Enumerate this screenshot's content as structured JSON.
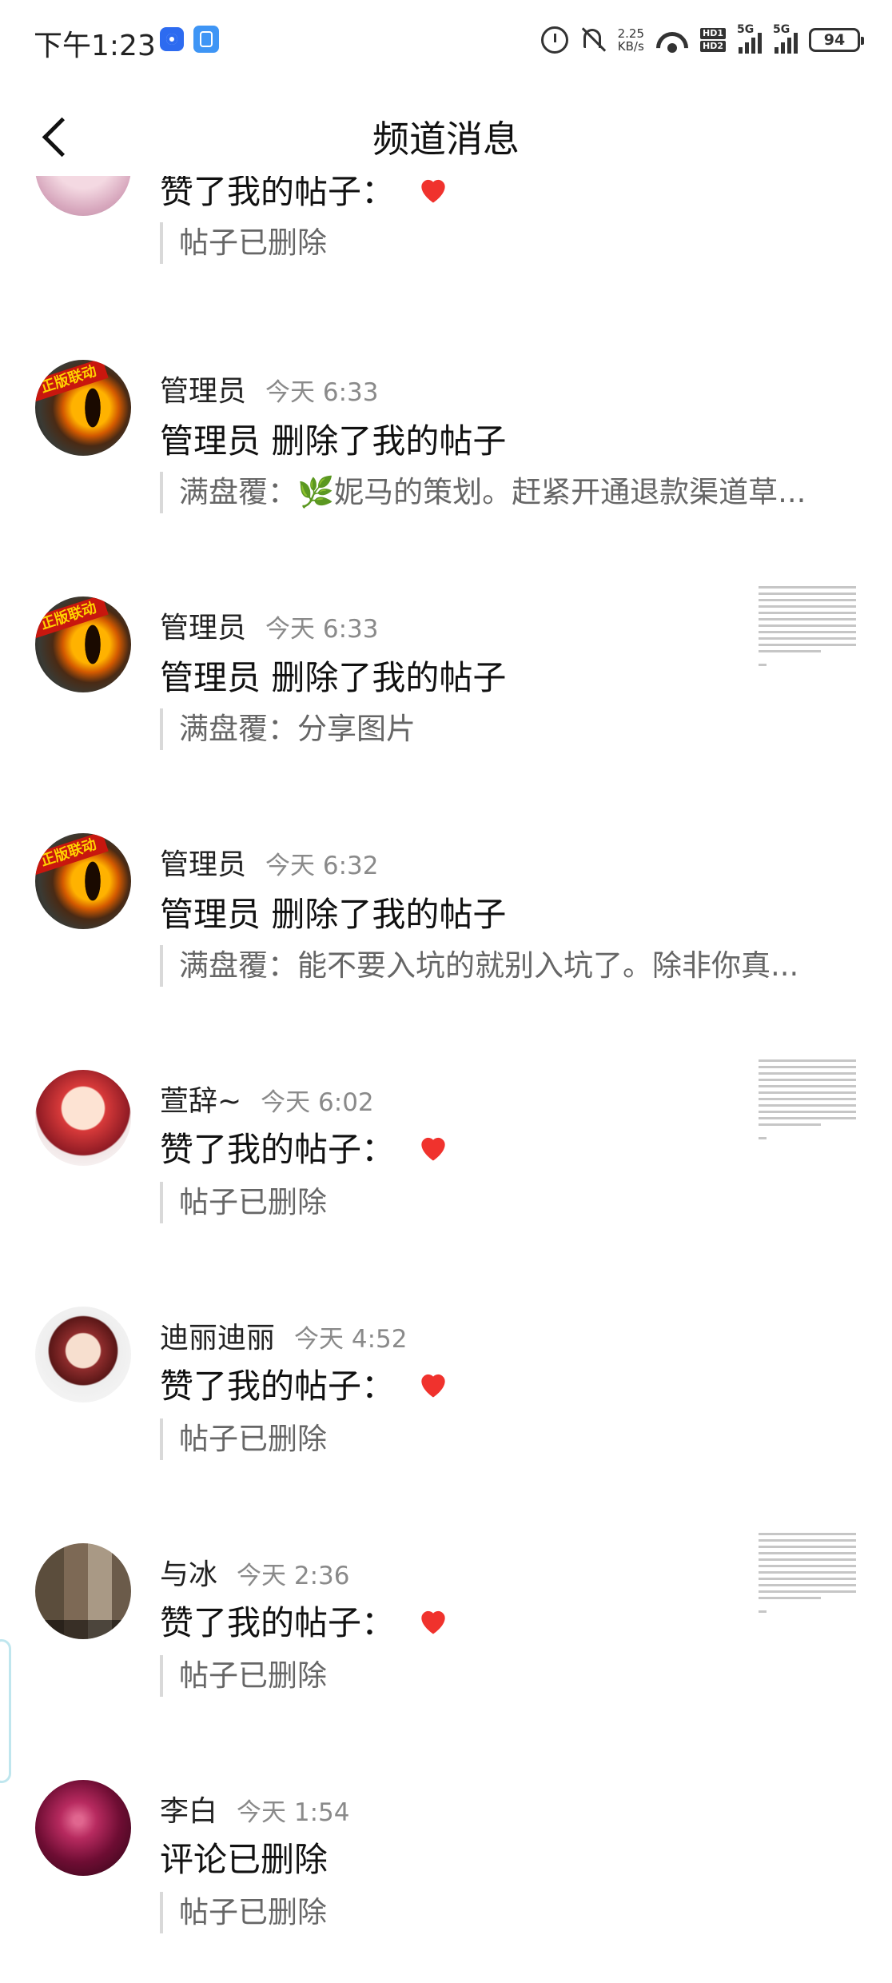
{
  "status_bar": {
    "time": "下午1:23",
    "speed_value": "2.25",
    "speed_unit": "KB/s",
    "hd1": "HD1",
    "hd2": "HD2",
    "net1": "5G",
    "net2": "5G",
    "battery": "94"
  },
  "header": {
    "title": "频道消息"
  },
  "messages": [
    {
      "name": "",
      "time": "",
      "action": "赞了我的帖子：",
      "heart": true,
      "quote": "帖子已删除",
      "avatar": "pink-avatar"
    },
    {
      "name": "管理员",
      "time": "今天 6:33",
      "action": "管理员 删除了我的帖子",
      "heart": false,
      "quote_prefix": "满盘覆：",
      "quote_emoji": "🌿",
      "quote": "妮马的策划。赶紧开通退款渠道草...",
      "avatar": "dragon-eye-avatar"
    },
    {
      "name": "管理员",
      "time": "今天 6:33",
      "action": "管理员 删除了我的帖子",
      "heart": false,
      "quote": "满盘覆：分享图片",
      "avatar": "dragon-eye-avatar",
      "banner": "正版联动"
    },
    {
      "name": "管理员",
      "time": "今天 6:32",
      "action": "管理员 删除了我的帖子",
      "heart": false,
      "quote": "满盘覆：能不要入坑的就别入坑了。除非你真...",
      "avatar": "dragon-eye-avatar"
    },
    {
      "name": "萱辞~",
      "time": "今天 6:02",
      "action": "赞了我的帖子：",
      "heart": true,
      "quote": "帖子已删除",
      "avatar": "anime-girl-avatar"
    },
    {
      "name": "迪丽迪丽",
      "time": "今天 4:52",
      "action": "赞了我的帖子：",
      "heart": true,
      "quote": "帖子已删除",
      "avatar": "anime-boy-avatar"
    },
    {
      "name": "与冰",
      "time": "今天 2:36",
      "action": "赞了我的帖子：",
      "heart": true,
      "quote": "帖子已删除",
      "avatar": "photo-avatar"
    },
    {
      "name": "李白",
      "time": "今天 1:54",
      "action": "评论已删除",
      "heart": false,
      "quote": "帖子已删除",
      "avatar": "sphere-avatar"
    }
  ],
  "colors": {
    "heart": "#f0322d",
    "quote_bar": "#d9d9d9",
    "time_text": "#8a8a8a"
  }
}
